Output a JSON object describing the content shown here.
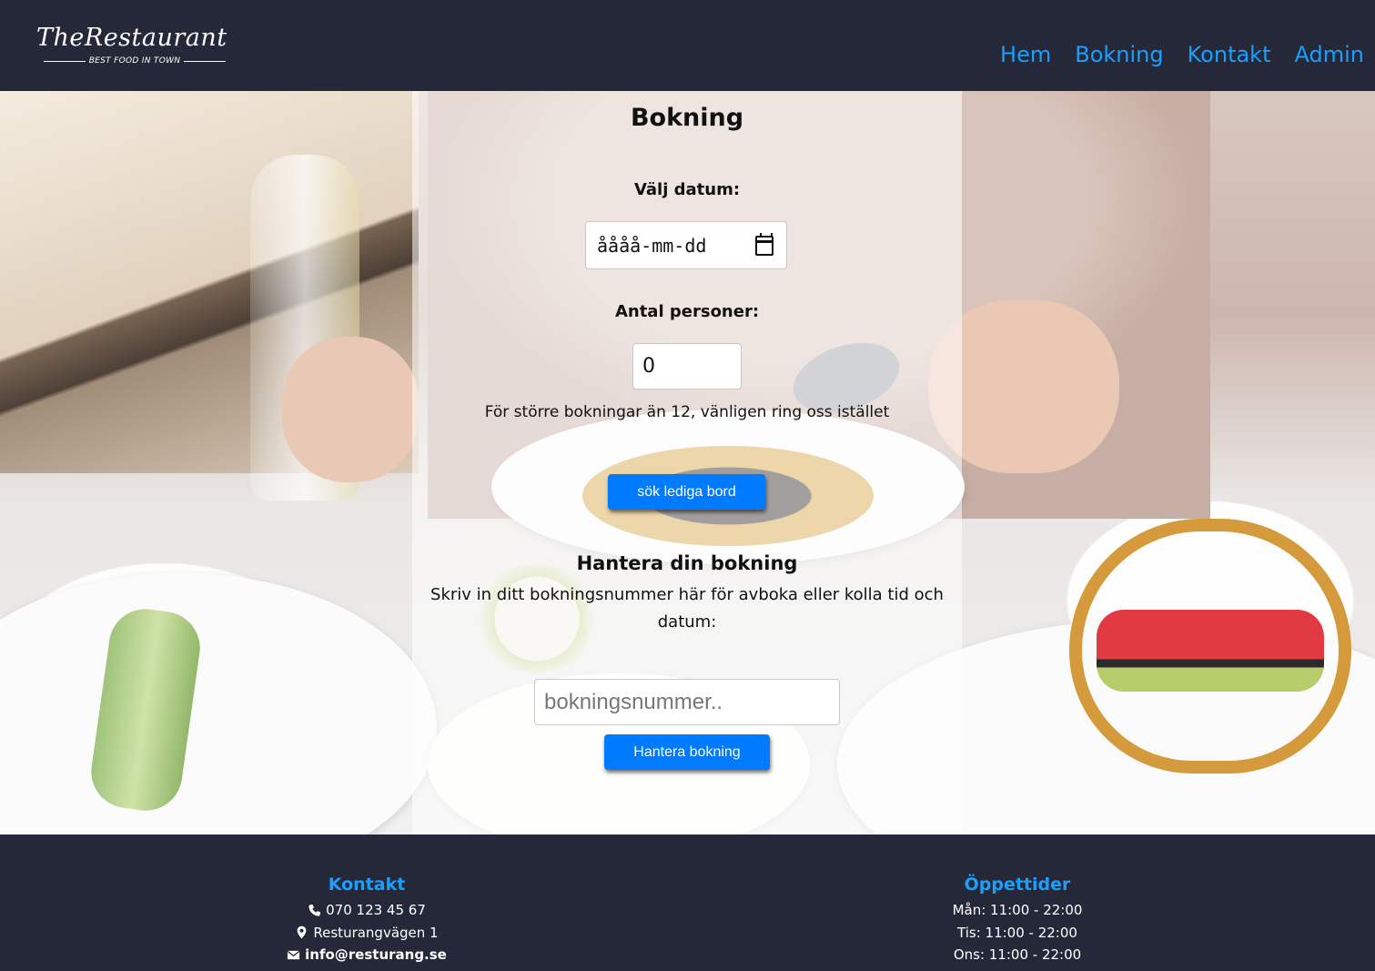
{
  "header": {
    "logo_title": "TheRestaurant",
    "logo_tagline": "BEST FOOD IN TOWN",
    "nav": [
      "Hem",
      "Bokning",
      "Kontakt",
      "Admin"
    ]
  },
  "booking": {
    "title": "Bokning",
    "date_label": "Välj datum:",
    "date_placeholder": "åååå-mm-dd",
    "persons_label": "Antal personer:",
    "persons_value": "0",
    "note": "För större bokningar än 12, vänligen ring oss istället",
    "search_button": "sök lediga bord"
  },
  "manage": {
    "title": "Hantera din bokning",
    "description": "Skriv in ditt bokningsnummer här för avboka eller kolla tid och datum:",
    "input_placeholder": "bokningsnummer..",
    "button": "Hantera bokning"
  },
  "footer": {
    "contact": {
      "title": "Kontakt",
      "phone": "070 123 45 67",
      "address": "Resturangvägen 1",
      "email": "info@resturang.se"
    },
    "hours": {
      "title": "Öppettider",
      "lines": [
        "Mån: 11:00 - 22:00",
        "Tis: 11:00 - 22:00",
        "Ons: 11:00 - 22:00"
      ]
    }
  },
  "colors": {
    "header_bg": "#252838",
    "accent": "#1a9fff",
    "button": "#007bff"
  },
  "icons": [
    "calendar-icon",
    "phone-icon",
    "map-marker-icon",
    "envelope-icon"
  ]
}
